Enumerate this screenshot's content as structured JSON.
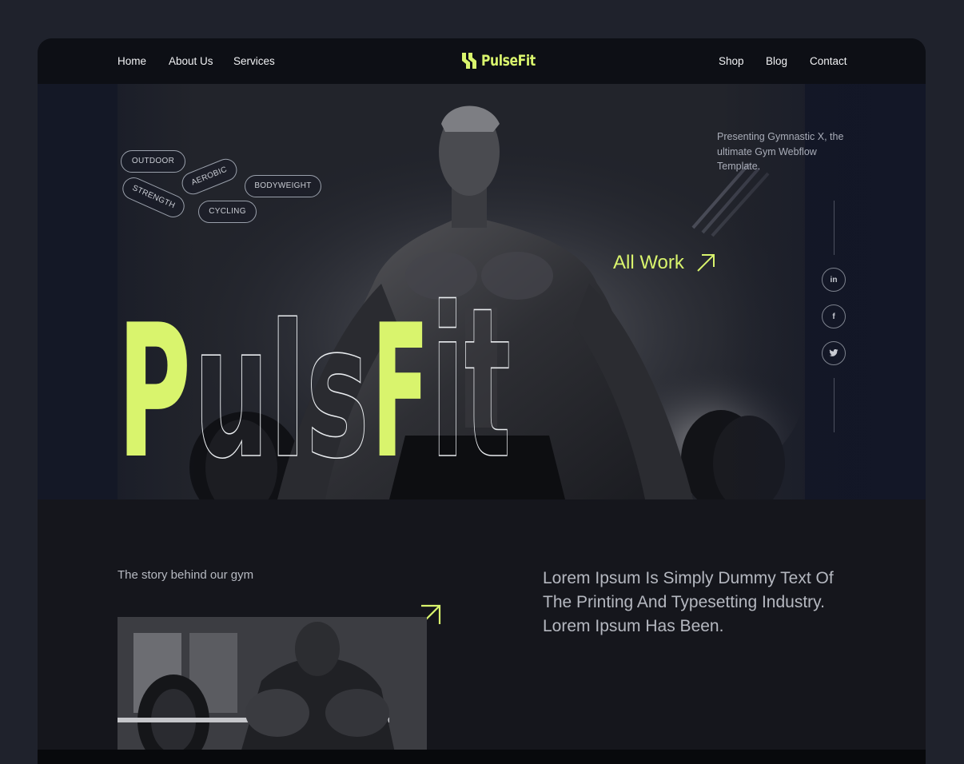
{
  "nav": {
    "left": [
      "Home",
      "About Us",
      "Services"
    ],
    "right": [
      "Shop",
      "Blog",
      "Contact"
    ],
    "brand": "PulseFit"
  },
  "hero": {
    "tags": [
      "OUTDOOR",
      "AEROBIC",
      "BODYWEIGHT",
      "STRENGTH",
      "CYCLING"
    ],
    "presenting": "Presenting Gymnastic X, the ultimate Gym Webflow Template.",
    "all_work": "All Work",
    "big_word": "PulsFit",
    "social": [
      "linkedin-icon",
      "facebook-icon",
      "twitter-icon"
    ]
  },
  "about": {
    "story_label": "The story behind our gym",
    "lorem": "Lorem Ipsum Is Simply Dummy Text Of The Printing And Typesetting Industry. Lorem Ipsum Has Been."
  },
  "colors": {
    "accent": "#d9f46d",
    "background": "#1f222c",
    "frame": "#14151b",
    "nav": "#0d0f15"
  }
}
